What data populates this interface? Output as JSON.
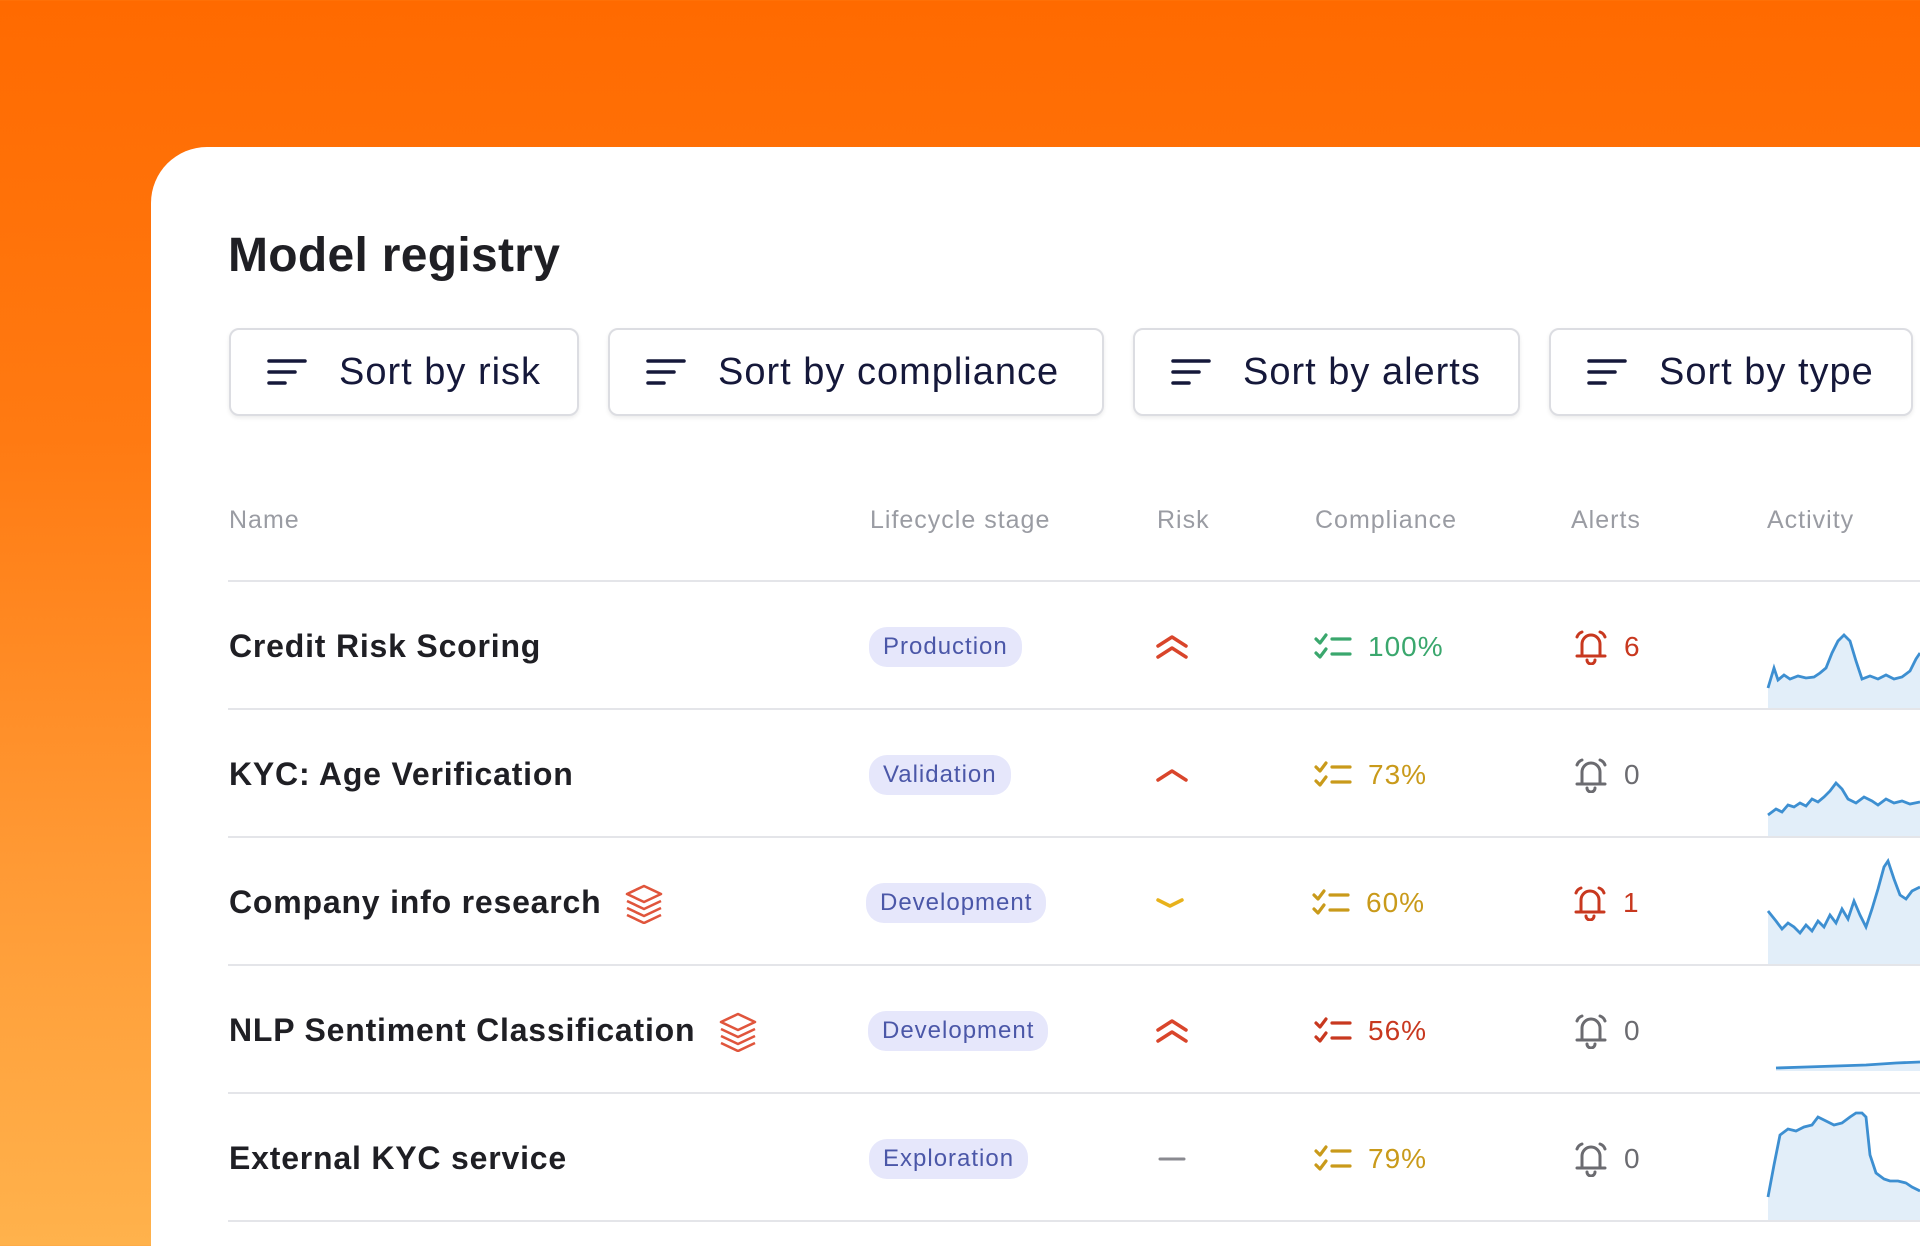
{
  "page": {
    "title": "Model registry"
  },
  "toolbar": {
    "sort_risk": "Sort by risk",
    "sort_compliance": "Sort by compliance",
    "sort_alerts": "Sort by alerts",
    "sort_type": "Sort by type"
  },
  "table": {
    "columns": {
      "name": "Name",
      "stage": "Lifecycle stage",
      "risk": "Risk",
      "compliance": "Compliance",
      "alerts": "Alerts",
      "activity": "Activity"
    },
    "rows": [
      {
        "name": "Credit Risk Scoring",
        "stage": "Production",
        "risk": "high",
        "risk_icon": "double-chevron-up-icon",
        "compliance": "100%",
        "compliance_color": "#3aa76d",
        "alerts": "6",
        "alerts_color": "#c8381f",
        "has_stack_icon": false
      },
      {
        "name": "KYC: Age Verification",
        "stage": "Validation",
        "risk": "medium",
        "risk_icon": "chevron-up-icon",
        "compliance": "73%",
        "compliance_color": "#c99a1a",
        "alerts": "0",
        "alerts_color": "#6b6b70",
        "has_stack_icon": false
      },
      {
        "name": "Company info research",
        "stage": "Development",
        "risk": "low",
        "risk_icon": "chevron-down-icon",
        "compliance": "60%",
        "compliance_color": "#c99a1a",
        "alerts": "1",
        "alerts_color": "#c8381f",
        "has_stack_icon": true
      },
      {
        "name": "NLP Sentiment Classification",
        "stage": "Development",
        "risk": "high",
        "risk_icon": "double-chevron-up-icon",
        "compliance": "56%",
        "compliance_color": "#c8381f",
        "alerts": "0",
        "alerts_color": "#6b6b70",
        "has_stack_icon": true
      },
      {
        "name": "External KYC service",
        "stage": "Exploration",
        "risk": "none",
        "risk_icon": "dash-icon",
        "compliance": "79%",
        "compliance_color": "#c99a1a",
        "alerts": "0",
        "alerts_color": "#6b6b70",
        "has_stack_icon": false
      }
    ]
  },
  "colors": {
    "accent_orange": "#ff6a00",
    "risk_high": "#d9452b",
    "risk_low": "#e8b21c",
    "risk_none": "#8a8a90",
    "sparkline": "#3d8fd1",
    "stage_badge_bg": "#e6e7fb",
    "stage_badge_text": "#4b57a8"
  },
  "icons": {
    "sort": "sort-lines-icon",
    "compliance": "checklist-icon",
    "alerts": "bell-icon",
    "stack": "stack-layers-icon"
  }
}
